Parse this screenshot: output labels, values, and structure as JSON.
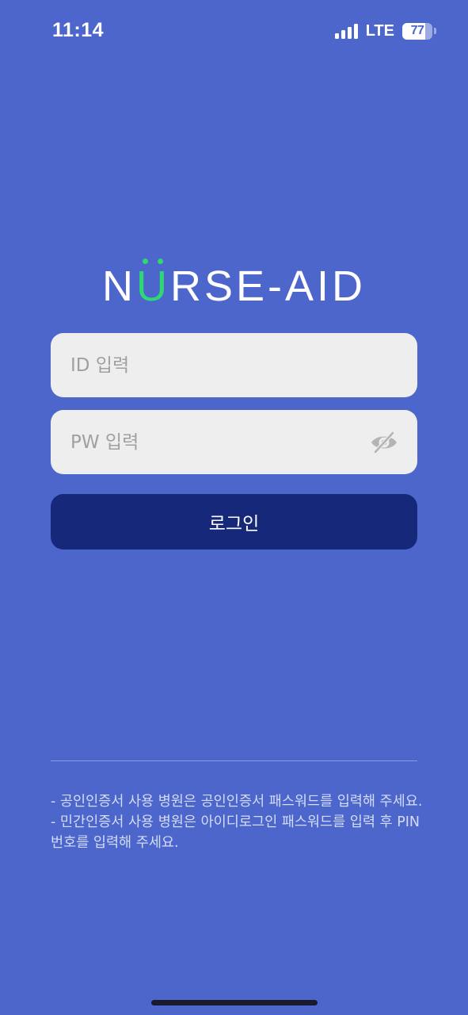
{
  "status_bar": {
    "time": "11:14",
    "network": "LTE",
    "battery_percent": "77",
    "battery_level": 0.77,
    "signal_bars": 4
  },
  "logo": {
    "prefix": "N",
    "accent_letter": "U",
    "suffix": "RSE-AID"
  },
  "login_form": {
    "id_placeholder": "ID 입력",
    "pw_placeholder": "PW 입력",
    "login_label": "로그인"
  },
  "notice": {
    "lines": [
      "- 공인인증서 사용 병원은 공인인증서 패스워드를 입력해 주세요.",
      "- 민간인증서 사용 병원은 아이디로그인 패스워드를 입력 후 PIN 번호를 입력해 주세요."
    ]
  },
  "colors": {
    "background": "#4c66cc",
    "input_background": "#eeeeee",
    "button_background": "#16287a",
    "logo_accent": "#2ed872"
  },
  "icons": {
    "password_toggle": "eye-slash-icon",
    "signal": "cellular-signal-icon",
    "battery": "battery-icon"
  }
}
